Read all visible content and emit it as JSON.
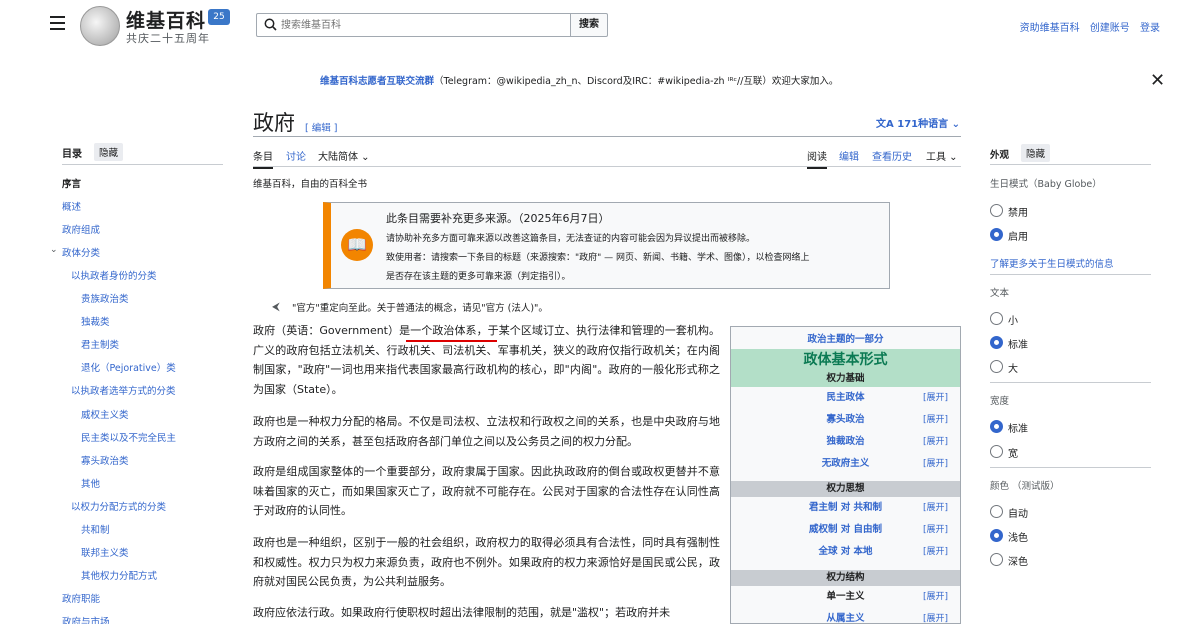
{
  "header": {
    "logo_title": "维基百科",
    "logo_badge": "25",
    "logo_subtitle": "共庆二十五周年",
    "search_placeholder": "搜索维基百科",
    "search_button": "搜索",
    "top_links": [
      "资助维基百科",
      "创建账号",
      "登录"
    ]
  },
  "banner": {
    "strong": "维基百科志愿者互联交流群",
    "text": "（Telegram：@wikipedia_zh_n、Discord及IRC：#wikipedia-zh ᴵᴿᶜ//互联）欢迎大家加入。"
  },
  "toc": {
    "title": "目录",
    "hide": "隐藏",
    "items": [
      {
        "label": "序言",
        "current": true
      },
      {
        "label": "概述"
      },
      {
        "label": "政府组成"
      },
      {
        "label": "政体分类"
      },
      {
        "label": "以执政者身份的分类"
      },
      {
        "label": "贵族政治类"
      },
      {
        "label": "独裁类"
      },
      {
        "label": "君主制类"
      },
      {
        "label": "退化（Pejorative）类"
      },
      {
        "label": "以执政者选举方式的分类"
      },
      {
        "label": "威权主义类"
      },
      {
        "label": "民主类以及不完全民主"
      },
      {
        "label": "寡头政治类"
      },
      {
        "label": "其他"
      },
      {
        "label": "以权力分配方式的分类"
      },
      {
        "label": "共和制"
      },
      {
        "label": "联邦主义类"
      },
      {
        "label": "其他权力分配方式"
      },
      {
        "label": "政府职能"
      },
      {
        "label": "政府与市场"
      }
    ]
  },
  "article": {
    "title": "政府",
    "edit": "[ 编辑 ]",
    "languages": "171种语言",
    "tabs": {
      "article": "条目",
      "talk": "讨论",
      "variant": "大陆简体",
      "read": "阅读",
      "edit": "编辑",
      "history": "查看历史",
      "tools": "工具"
    },
    "tagline": "维基百科，自由的百科全书",
    "ambox": {
      "line1": "此条目需要补充更多来源。（2025年6月7日）",
      "line2": "请协助补充多方面可靠来源以改善这篇条目，无法查证的内容可能会因为异议提出而被移除。",
      "line3": "致使用者：请搜索一下条目的标题（来源搜索：\"政府\" — 网页、新闻、书籍、学术、图像），以检查网络上",
      "line4": "是否存在该主题的更多可靠来源（判定指引）。"
    },
    "hatnote": "\"官方\"重定向至此。关于普通法的概念，请见\"官方 (法人)\"。",
    "paragraphs": [
      "政府（英语：Government）是一个政治体系，于某个区域订立、执行法律和管理的一套机构。广义的政府包括立法机关、行政机关、司法机关、军事机关，狭义的政府仅指行政机关；在内阁制国家，\"政府\"一词也用来指代表国家最高行政机构的核心，即\"内阁\"。政府的一般化形式称之为国家（State）。",
      "政府也是一种权力分配的格局。不仅是司法权、立法权和行政权之间的关系，也是中央政府与地方政府之间的关系，甚至包括政府各部门单位之间以及公务员之间的权力分配。",
      "政府是组成国家整体的一个重要部分，政府隶属于国家。因此执政政府的倒台或政权更替并不意味着国家的灭亡，而如果国家灭亡了，政府就不可能存在。公民对于国家的合法性存在认同性高于对政府的认同性。",
      "政府也是一种组织，区别于一般的社会组织，政府权力的取得必须具有合法性，同时具有强制性和权威性。权力只为权力来源负责，政府也不例外。如果政府的权力来源恰好是国民或公民，政府就对国民公民负责，为公共利益服务。",
      "政府应依法行政。如果政府行使职权时超出法律限制的范围，就是\"滥权\"；若政府并未"
    ]
  },
  "infobox": {
    "series": "政治主题的一部分",
    "title": "政体基本形式",
    "sections": [
      {
        "head": "权力基础",
        "items": [
          "民主政体",
          "寡头政治",
          "独裁政治",
          "无政府主义"
        ]
      },
      {
        "head": "权力思想",
        "items": [
          "君主制 对 共和制",
          "威权制 对 自由制",
          "全球 对 本地"
        ]
      },
      {
        "head": "权力结构",
        "items": [
          "单一主义",
          "从属主义"
        ]
      }
    ],
    "expand": "[展开]"
  },
  "appearance": {
    "title": "外观",
    "hide": "隐藏",
    "birthday_label": "生日模式（Baby Globe）",
    "birthday_options": [
      "禁用",
      "启用"
    ],
    "birthday_selected": "启用",
    "more_link": "了解更多关于生日模式的信息",
    "text_label": "文本",
    "text_options": [
      "小",
      "标准",
      "大"
    ],
    "text_selected": "标准",
    "width_label": "宽度",
    "width_options": [
      "标准",
      "宽"
    ],
    "width_selected": "标准",
    "color_label": "颜色 （测试版）",
    "color_options": [
      "自动",
      "浅色",
      "深色"
    ],
    "color_selected": "浅色"
  },
  "colors": {
    "link": "#3366cc",
    "ambox_accent": "#f28500",
    "infobox_title": "#0b7a53"
  }
}
